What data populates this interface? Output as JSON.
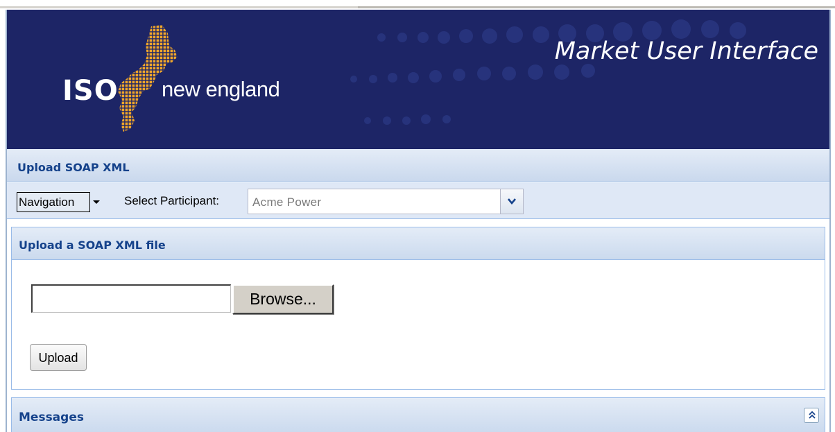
{
  "header": {
    "logo_iso": "ISO",
    "logo_region": "new england",
    "app_title": "Market User Interface"
  },
  "page": {
    "title": "Upload SOAP XML"
  },
  "toolbar": {
    "navigation_label": "Navigation",
    "participant_label": "Select Participant:",
    "participant_value": "Acme Power"
  },
  "upload_panel": {
    "title": "Upload a SOAP XML file",
    "file_value": "",
    "browse_label": "Browse...",
    "upload_label": "Upload"
  },
  "messages_panel": {
    "title": "Messages"
  },
  "colors": {
    "banner_bg": "#1d2566",
    "logo_gold": "#f0a62a",
    "panel_title": "#15428b",
    "panel_border": "#99bbe8"
  },
  "icons": {
    "navigation_menu": "dropdown-arrow-icon",
    "participant_combo": "chevron-down-icon",
    "messages_tool": "double-chevron-up-icon"
  }
}
